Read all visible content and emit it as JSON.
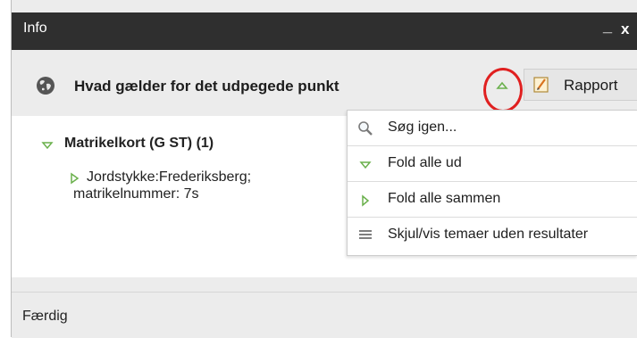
{
  "window": {
    "title": "Info",
    "minimize_glyph": "_",
    "close_glyph": "x"
  },
  "header": {
    "text": "Hvad gælder for det udpegede punkt",
    "rapport_label": "Rapport"
  },
  "tree": {
    "group_label": "Matrikelkort (G ST) (1)",
    "item_line1": "Jordstykke:Frederiksberg;",
    "item_line2": "matrikelnummer: 7s"
  },
  "menu": {
    "items": [
      {
        "label": "Søg igen...",
        "icon": "search-icon"
      },
      {
        "label": "Fold alle ud",
        "icon": "triangle-down-icon"
      },
      {
        "label": "Fold alle sammen",
        "icon": "triangle-right-icon"
      },
      {
        "label": "Skjul/vis temaer uden resultater",
        "icon": "list-icon"
      }
    ]
  },
  "status": {
    "text": "Færdig"
  },
  "colors": {
    "accent_green": "#6ab04c",
    "highlight_red": "#e02020",
    "titlebar": "#2f2f2f"
  }
}
